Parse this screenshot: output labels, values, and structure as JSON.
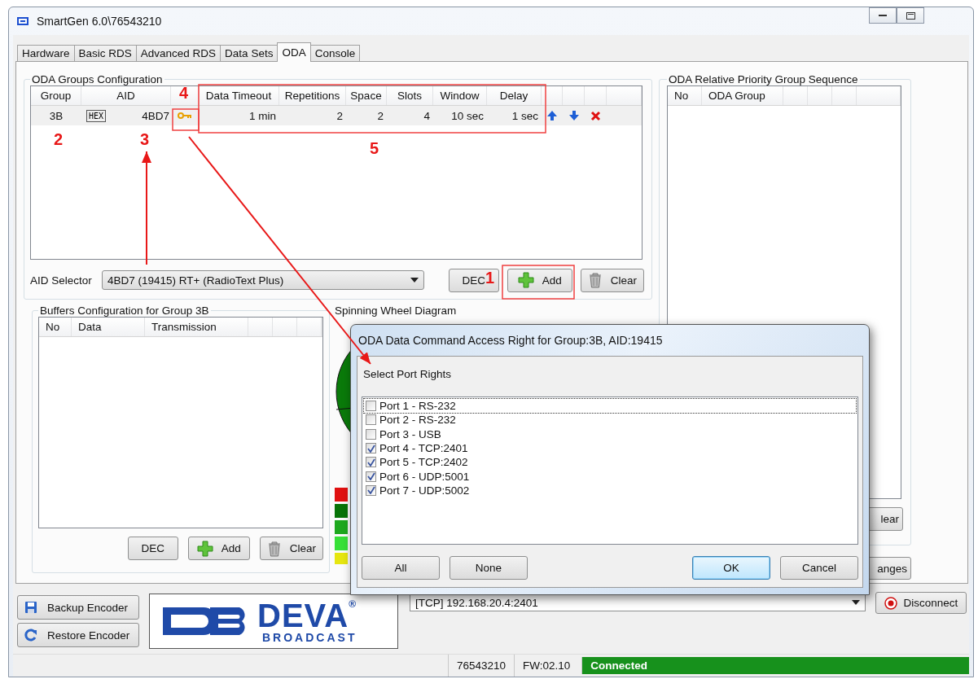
{
  "window": {
    "title": "SmartGen 6.0\\76543210"
  },
  "tabs": [
    {
      "label": "Hardware",
      "selected": false
    },
    {
      "label": "Basic RDS",
      "selected": false
    },
    {
      "label": "Advanced RDS",
      "selected": false
    },
    {
      "label": "Data Sets",
      "selected": false
    },
    {
      "label": "ODA",
      "selected": true
    },
    {
      "label": "Console",
      "selected": false
    }
  ],
  "oda_groups": {
    "title": "ODA Groups Configuration",
    "columns": [
      "Group",
      "AID",
      "Data Timeout",
      "Repetitions",
      "Space",
      "Slots",
      "Window",
      "Delay"
    ],
    "rows": [
      {
        "group": "3B",
        "aid_format": "HEX",
        "aid": "4BD7",
        "data_timeout": "1 min",
        "repetitions": "2",
        "space": "2",
        "slots": "4",
        "window": "10 sec",
        "delay": "1 sec"
      }
    ],
    "aid_selector": {
      "label": "AID Selector",
      "value": "4BD7 (19415) RT+ (RadioText Plus)"
    },
    "buttons": [
      {
        "label": "DEC",
        "kind": "plain"
      },
      {
        "label": "Add",
        "kind": "add"
      },
      {
        "label": "Clear",
        "kind": "clear"
      }
    ]
  },
  "buffers": {
    "title": "Buffers Configuration for Group 3B",
    "columns": [
      "No",
      "Data",
      "Transmission"
    ],
    "buttons": [
      {
        "label": "DEC",
        "kind": "plain"
      },
      {
        "label": "Add",
        "kind": "add"
      },
      {
        "label": "Clear",
        "kind": "clear"
      }
    ]
  },
  "spinning_wheel": {
    "title": "Spinning Wheel Diagram"
  },
  "priority": {
    "title": "ODA Relative Priority Group Sequence",
    "columns": [
      "No",
      "ODA Group"
    ],
    "clear_button": "lear"
  },
  "save_button": "anges",
  "encoder_buttons": [
    {
      "label": "Backup Encoder",
      "kind": "backup"
    },
    {
      "label": "Restore Encoder",
      "kind": "restore"
    }
  ],
  "logo": {
    "name": "DEVA",
    "mark": "®",
    "sub": "BROADCAST"
  },
  "connection": {
    "value": "[TCP] 192.168.20.4:2401"
  },
  "disconnect_button": "Disconnect",
  "status_bar": [
    {
      "text": "76543210",
      "kind": "plain"
    },
    {
      "text": "FW:02.10",
      "kind": "plain"
    },
    {
      "text": "Connected",
      "kind": "status"
    }
  ],
  "dialog": {
    "title": "ODA Data Command Access Right for Group:3B, AID:19415",
    "prompt": "Select Port Rights",
    "ports": [
      {
        "label": "Port 1 - RS-232",
        "checked": false,
        "focused": true
      },
      {
        "label": "Port 2 - RS-232",
        "checked": false,
        "focused": false
      },
      {
        "label": "Port 3 - USB",
        "checked": false,
        "focused": false
      },
      {
        "label": "Port 4 - TCP:2401",
        "checked": true,
        "focused": false
      },
      {
        "label": "Port 5 - TCP:2402",
        "checked": true,
        "focused": false
      },
      {
        "label": "Port 6 - UDP:5001",
        "checked": true,
        "focused": false
      },
      {
        "label": "Port 7 - UDP:5002",
        "checked": true,
        "focused": false
      }
    ],
    "buttons": [
      {
        "label": "All",
        "default": false
      },
      {
        "label": "None",
        "default": false
      },
      {
        "label": "OK",
        "default": true
      },
      {
        "label": "Cancel",
        "default": false
      }
    ]
  },
  "annotations": [
    "1",
    "2",
    "3",
    "4",
    "5"
  ]
}
